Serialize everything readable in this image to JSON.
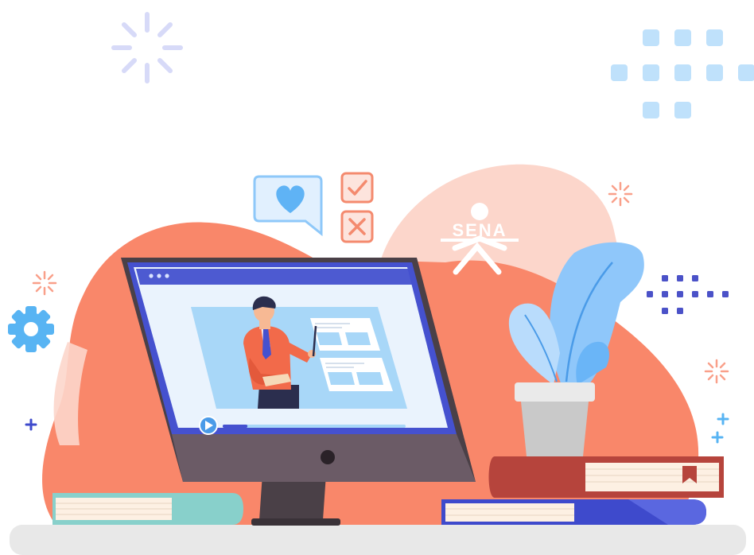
{
  "logo": {
    "text": "SENA"
  },
  "video_player": {
    "play_icon": "play-icon",
    "progress_fraction": 0.12
  },
  "colors": {
    "coral": "#F9876A",
    "pale_pink": "#FCD6CB",
    "monitor_frame": "#4A4047",
    "screen_blue": "#4551CF",
    "screen_bg": "#EAF3FD",
    "slide_blue": "#A8D7F8",
    "teal_book": "#88D0CB",
    "red_book": "#B6443C",
    "blue_book": "#3E4ACC",
    "plant_blue": "#8FC7FA",
    "shelf": "#E8E8E8"
  }
}
